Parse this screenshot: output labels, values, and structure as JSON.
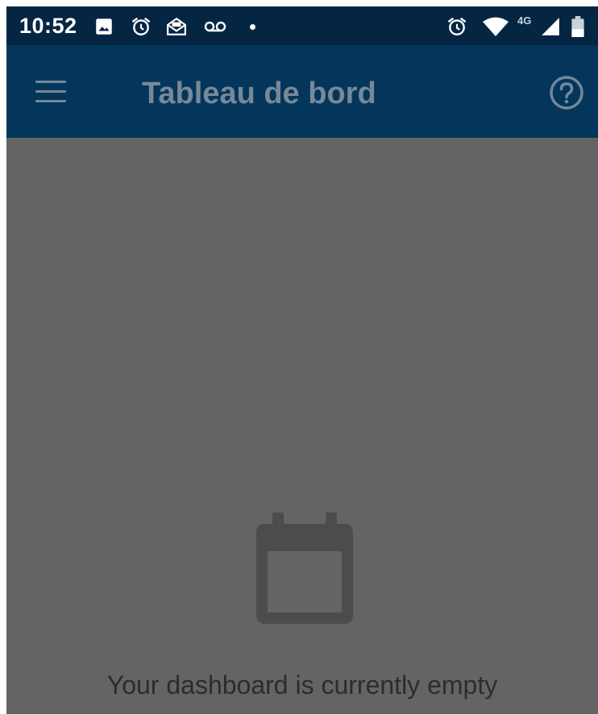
{
  "status_bar": {
    "time": "10:52",
    "network_label": "4G",
    "icons": [
      "image-icon",
      "alarm-icon",
      "mail-icon",
      "voicemail-icon",
      "notification-dot-icon",
      "alarm-icon",
      "wifi-icon",
      "signal-icon",
      "battery-icon"
    ]
  },
  "app_bar": {
    "title": "Tableau de bord",
    "menu_icon": "hamburger-menu-icon",
    "help_icon": "help-circle-icon"
  },
  "empty_state": {
    "icon": "calendar-icon",
    "message": "Your dashboard is currently empty"
  },
  "colors": {
    "status_bar_bg": "#042643",
    "app_bar_bg": "#03365a",
    "scrim_bg": "#646464",
    "muted_icon": "#72879a",
    "empty_icon": "#4c4c4c",
    "message_text": "#2c2c2c"
  }
}
